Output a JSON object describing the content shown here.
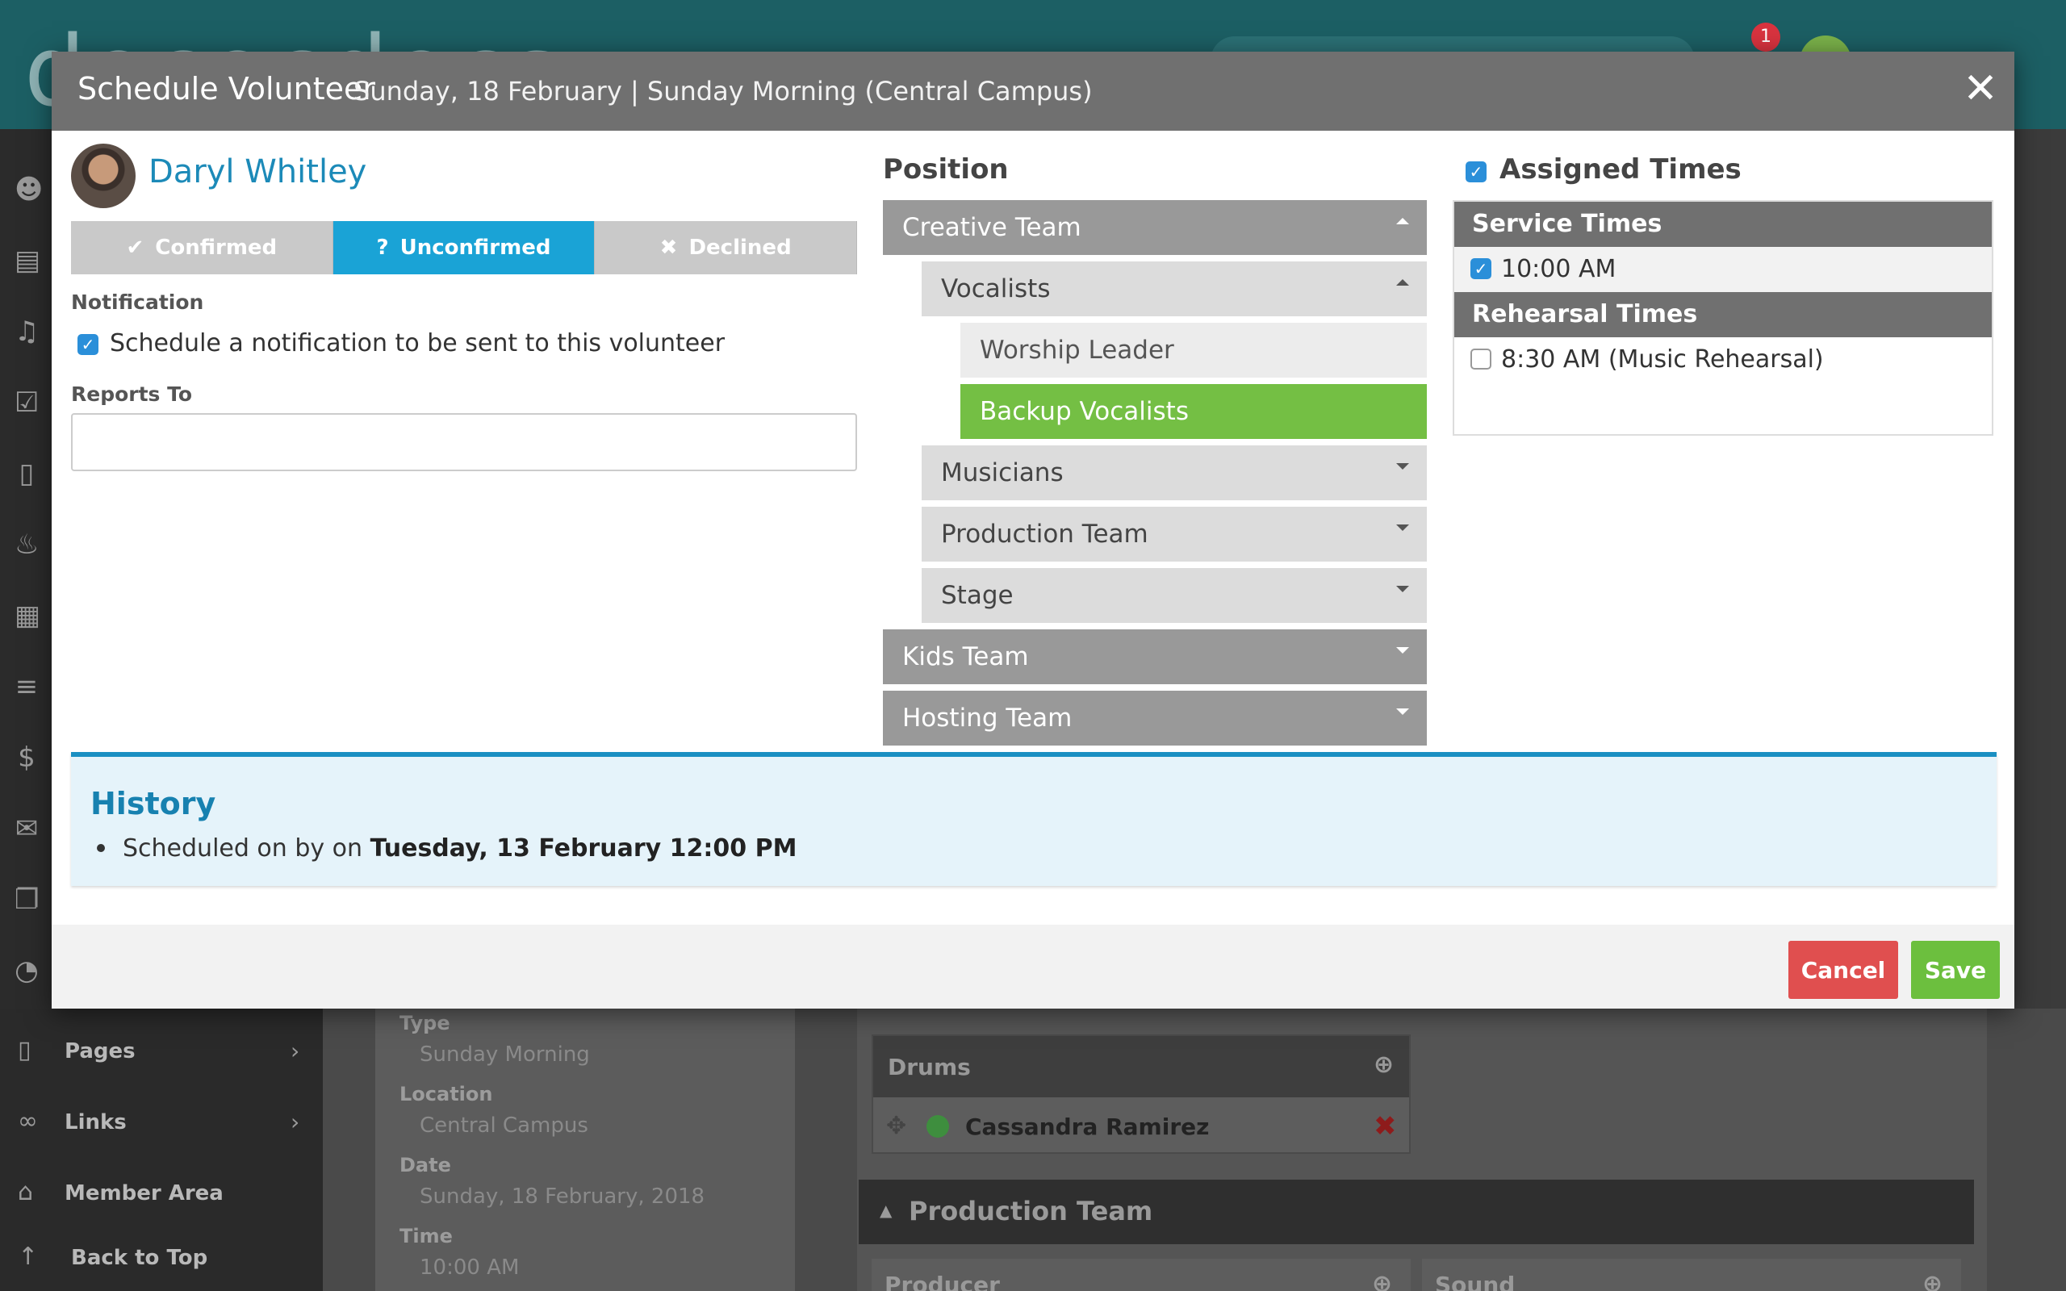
{
  "background": {
    "logo_text": "dococdocs",
    "notification_count": "1",
    "sidebar": [
      {
        "icon": "page-icon",
        "label": "Pages",
        "chevron": "›"
      },
      {
        "icon": "link-icon",
        "label": "Links",
        "chevron": "›"
      },
      {
        "icon": "home-icon",
        "label": "Member Area",
        "chevron": ""
      },
      {
        "icon": "arrow-up-icon",
        "label": "Back to Top",
        "chevron": ""
      }
    ],
    "details": [
      {
        "label": "Type",
        "value": "Sunday Morning"
      },
      {
        "label": "Location",
        "value": "Central Campus"
      },
      {
        "label": "Date",
        "value": "Sunday, 18 February, 2018"
      },
      {
        "label": "Time",
        "value": "10:00 AM"
      }
    ],
    "drums": {
      "title": "Drums",
      "person": "Cassandra Ramirez"
    },
    "production_team": "Production Team",
    "subpositions": [
      "Producer",
      "Sound"
    ]
  },
  "modal": {
    "title": "Schedule Volunteer",
    "subtitle": "Sunday, 18 February | Sunday Morning (Central Campus)",
    "close_glyph": "✕"
  },
  "volunteer": {
    "name": "Daryl Whitley",
    "statuses": [
      {
        "icon": "✔",
        "label": "Confirmed"
      },
      {
        "icon": "?",
        "label": "Unconfirmed"
      },
      {
        "icon": "✖",
        "label": "Declined"
      }
    ],
    "active_status": "Unconfirmed",
    "notification_label": "Notification",
    "notification_text": "Schedule a notification to be sent to this volunteer",
    "notification_checked": true,
    "reports_to_label": "Reports To",
    "reports_to_value": ""
  },
  "position": {
    "heading": "Position",
    "items": [
      {
        "label": "Creative Team",
        "level": "team",
        "caret": "up"
      },
      {
        "label": "Vocalists",
        "level": "sub",
        "caret": "up"
      },
      {
        "label": "Worship Leader",
        "level": "leaf",
        "caret": ""
      },
      {
        "label": "Backup Vocalists",
        "level": "leaf",
        "caret": "",
        "selected": true
      },
      {
        "label": "Musicians",
        "level": "sub",
        "caret": "down"
      },
      {
        "label": "Production Team",
        "level": "sub",
        "caret": "down"
      },
      {
        "label": "Stage",
        "level": "sub",
        "caret": "down"
      },
      {
        "label": "Kids Team",
        "level": "team",
        "caret": "down"
      },
      {
        "label": "Hosting Team",
        "level": "team",
        "caret": "down"
      }
    ]
  },
  "assigned_times": {
    "heading": "Assigned Times",
    "checked": true,
    "groups": [
      {
        "title": "Service Times",
        "times": [
          {
            "label": "10:00 AM",
            "checked": true
          }
        ]
      },
      {
        "title": "Rehearsal Times",
        "times": [
          {
            "label": "8:30 AM (Music Rehearsal)",
            "checked": false
          }
        ]
      }
    ]
  },
  "history": {
    "title": "History",
    "entry_prefix": "Scheduled on by on ",
    "entry_date": "Tuesday, 13 February 12:00 PM"
  },
  "footer": {
    "cancel_label": "Cancel",
    "save_label": "Save"
  },
  "colors": {
    "accent_blue": "#1aa3d6",
    "selected_green": "#74bf44",
    "cancel_red": "#e04f4f",
    "save_green": "#6cbf3e",
    "header_gray": "#707070"
  }
}
